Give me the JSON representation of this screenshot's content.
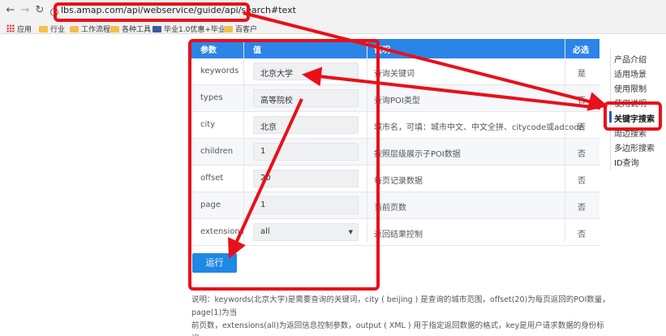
{
  "browser": {
    "url": "lbs.amap.com/api/webservice/guide/api/search#text",
    "bookmarks": [
      "应用",
      "行业",
      "工作流程",
      "各种工具",
      "毕业1.0优惠+毕业",
      "百客户"
    ]
  },
  "table": {
    "headers": {
      "param": "参数",
      "value": "值",
      "desc": "说明",
      "required": "必选"
    },
    "rows": [
      {
        "name": "keywords",
        "value": "北京大学",
        "desc": "查询关键词",
        "required": "是"
      },
      {
        "name": "types",
        "value": "高等院校",
        "desc": "查询POI类型",
        "required": "否"
      },
      {
        "name": "city",
        "value": "北京",
        "desc": "城市名，可填：城市中文、中文全拼、citycode或adcode",
        "required": "否"
      },
      {
        "name": "children",
        "value": "1",
        "desc": "按照层级展示子POI数据",
        "required": "否"
      },
      {
        "name": "offset",
        "value": "20",
        "desc": "每页记录数据",
        "required": "否"
      },
      {
        "name": "page",
        "value": "1",
        "desc": "当前页数",
        "required": "否"
      },
      {
        "name": "extensions",
        "value": "all",
        "desc": "返回结果控制",
        "required": "否"
      }
    ]
  },
  "run_label": "运行",
  "note_line1": "说明：keywords(北京大学)是需要查询的关键词，city ( beijing ) 是查询的城市范围，offset(20)为每页返回的POI数量，page(1)为当",
  "note_line2": "前页数，extensions(all)为返回信息控制参数，output ( XML ) 用于指定返回数据的格式，key是用户请求数据的身份标识。",
  "side_nav": [
    "产品介绍",
    "适用场景",
    "使用限制",
    "使用说明",
    "关键字搜索",
    "周边搜索",
    "多边形搜索",
    "ID查询"
  ],
  "colors": {
    "header": "#2b84e8",
    "button": "#1e88e5",
    "annotation": "#e8101a"
  }
}
